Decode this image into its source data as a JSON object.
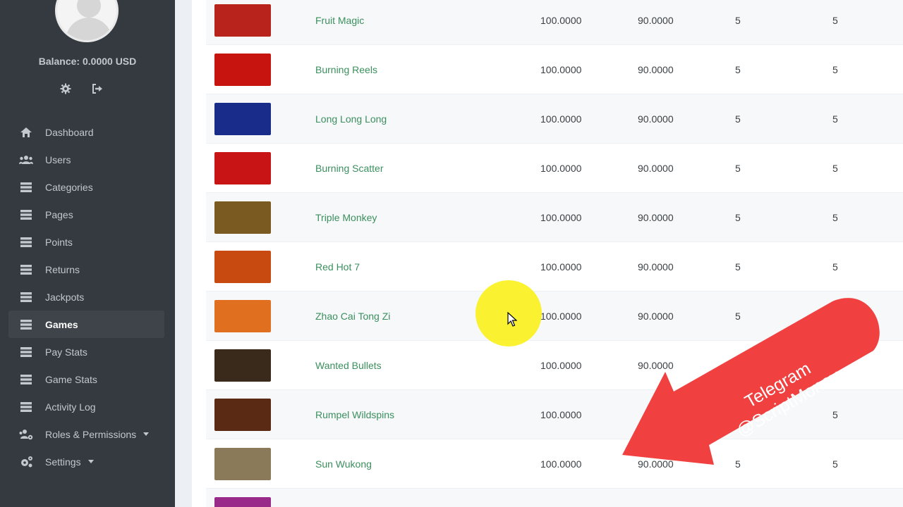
{
  "sidebar": {
    "balance": "Balance: 0.0000 USD",
    "nav": [
      {
        "label": "Dashboard",
        "icon": "home-icon"
      },
      {
        "label": "Users",
        "icon": "users-icon"
      },
      {
        "label": "Categories",
        "icon": "list-icon"
      },
      {
        "label": "Pages",
        "icon": "list-icon"
      },
      {
        "label": "Points",
        "icon": "list-icon"
      },
      {
        "label": "Returns",
        "icon": "list-icon"
      },
      {
        "label": "Jackpots",
        "icon": "list-icon"
      },
      {
        "label": "Games",
        "icon": "list-icon",
        "active": true
      },
      {
        "label": "Pay Stats",
        "icon": "list-icon"
      },
      {
        "label": "Game Stats",
        "icon": "list-icon"
      },
      {
        "label": "Activity Log",
        "icon": "list-icon"
      },
      {
        "label": "Roles & Permissions",
        "icon": "users-cog-icon"
      },
      {
        "label": "Settings",
        "icon": "cogs-icon"
      }
    ]
  },
  "games": [
    {
      "name": "Fruit Magic",
      "v1": "100.0000",
      "v2": "90.0000",
      "v3": "5",
      "v4": "5"
    },
    {
      "name": "Burning Reels",
      "v1": "100.0000",
      "v2": "90.0000",
      "v3": "5",
      "v4": "5"
    },
    {
      "name": "Long Long Long",
      "v1": "100.0000",
      "v2": "90.0000",
      "v3": "5",
      "v4": "5"
    },
    {
      "name": "Burning Scatter",
      "v1": "100.0000",
      "v2": "90.0000",
      "v3": "5",
      "v4": "5"
    },
    {
      "name": "Triple Monkey",
      "v1": "100.0000",
      "v2": "90.0000",
      "v3": "5",
      "v4": "5"
    },
    {
      "name": "Red Hot 7",
      "v1": "100.0000",
      "v2": "90.0000",
      "v3": "5",
      "v4": "5"
    },
    {
      "name": "Zhao Cai Tong Zi",
      "v1": "100.0000",
      "v2": "90.0000",
      "v3": "5",
      "v4": ""
    },
    {
      "name": "Wanted Bullets",
      "v1": "100.0000",
      "v2": "90.0000",
      "v3": "",
      "v4": ""
    },
    {
      "name": "Rumpel Wildspins",
      "v1": "100.0000",
      "v2": "",
      "v3": "",
      "v4": "5"
    },
    {
      "name": "Sun Wukong",
      "v1": "100.0000",
      "v2": "90.0000",
      "v3": "5",
      "v4": "5"
    }
  ],
  "promo": {
    "line1": "Telegram",
    "line2": "@ScriptMoney",
    "color": "#f04040"
  },
  "thumb_colors": [
    "#b8241c",
    "#c8140e",
    "#1a2c8a",
    "#c81414",
    "#7a5a20",
    "#c84a10",
    "#e07020",
    "#3a2a1c",
    "#5a2a14",
    "#8a7a5a",
    "#9a2a8a"
  ]
}
